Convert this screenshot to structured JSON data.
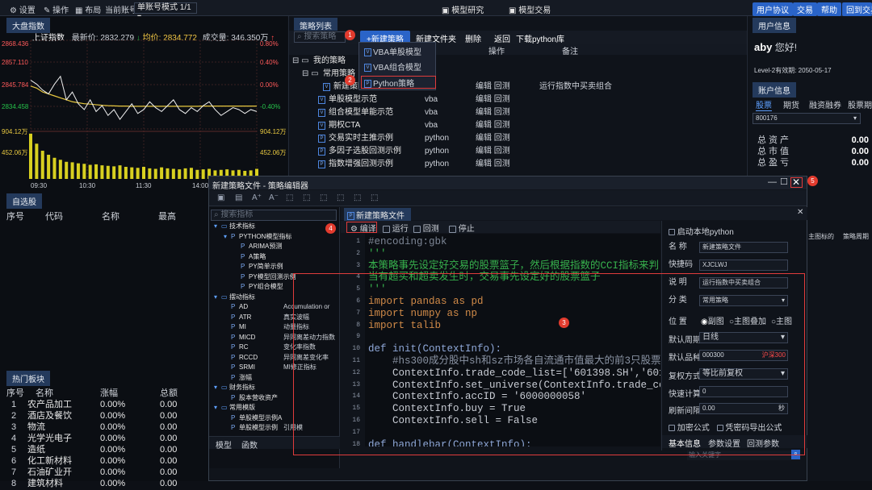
{
  "topbar": {
    "settings": "设置",
    "ops": "操作",
    "layout": "布局",
    "account_label": "当前账号",
    "account_mode": "单账号模式 1/1",
    "model_research": "模型研究",
    "model_trade": "模型交易",
    "user_agreement": "用户协议",
    "trade": "交易",
    "help": "帮助",
    "back_to_trade": "回到交易"
  },
  "market": {
    "tab": "大盘指数",
    "index_name": "上证指数",
    "latest": "最新价: 2832.279",
    "avg": "均价: 2834.772",
    "volume": "成交量: 346.350万",
    "y_left": [
      "2868.436",
      "2857.110",
      "2845.784",
      "2834.458"
    ],
    "y_right": [
      "0.80%",
      "0.40%",
      "0.00%",
      "-0.40%"
    ],
    "vol_left": [
      "904.12万",
      "452.06万"
    ],
    "vol_right": [
      "904.12万",
      "452.06万"
    ],
    "times": [
      "09:30",
      "10:30",
      "11:30",
      "14:00"
    ]
  },
  "chart_data": {
    "type": "line",
    "title": "上证指数",
    "x": [
      "09:30",
      "10:30",
      "11:30",
      "14:00"
    ],
    "ylim": [
      2823.1,
      2868.436
    ],
    "price": [
      2848,
      2846,
      2843,
      2841,
      2846,
      2850,
      2838,
      2842,
      2836,
      2833,
      2838,
      2832,
      2835,
      2830,
      2833,
      2828,
      2832,
      2836,
      2831,
      2833,
      2837,
      2834,
      2832,
      2835,
      2838,
      2833,
      2831,
      2834,
      2832,
      2835,
      2837,
      2833,
      2830,
      2832,
      2834,
      2833,
      2831,
      2833,
      2832
    ],
    "avg": [
      2845,
      2844,
      2842,
      2841,
      2840,
      2839,
      2838,
      2837,
      2836.5,
      2836,
      2835.8,
      2835.5,
      2835.2,
      2835,
      2834.9,
      2834.8,
      2834.8,
      2834.7,
      2834.7,
      2834.7,
      2834.7,
      2834.7,
      2834.7,
      2834.7,
      2834.7,
      2834.7,
      2834.7,
      2834.7,
      2834.7,
      2834.8,
      2834.8,
      2834.8,
      2834.8,
      2834.8,
      2834.8,
      2834.8,
      2834.8,
      2834.8,
      2834.8
    ],
    "volume": [
      900,
      700,
      560,
      480,
      420,
      380,
      340,
      330,
      310,
      300,
      280,
      290,
      270,
      260,
      250,
      270,
      240,
      230,
      220,
      240,
      210,
      200,
      230,
      210,
      200,
      190,
      210,
      220,
      180,
      190,
      200,
      170,
      180,
      190,
      170,
      180,
      160,
      170,
      200
    ]
  },
  "watchlist": {
    "tab": "自选股",
    "cols": [
      "序号",
      "代码",
      "名称",
      "最高"
    ]
  },
  "hot": {
    "tab": "热门板块",
    "cols": [
      "序号",
      "名称",
      "涨幅",
      "总额"
    ],
    "rows": [
      [
        "1",
        "农产品加工",
        "0.00%",
        "0.00"
      ],
      [
        "2",
        "酒店及餐饮",
        "0.00%",
        "0.00"
      ],
      [
        "3",
        "物流",
        "0.00%",
        "0.00"
      ],
      [
        "4",
        "光学光电子",
        "0.00%",
        "0.00"
      ],
      [
        "5",
        "造纸",
        "0.00%",
        "0.00"
      ],
      [
        "6",
        "化工新材料",
        "0.00%",
        "0.00"
      ],
      [
        "7",
        "石油矿业开",
        "0.00%",
        "0.00"
      ],
      [
        "8",
        "建筑材料",
        "0.00%",
        "0.00"
      ]
    ]
  },
  "strategy": {
    "tab": "策略列表",
    "search_placeholder": "搜索策略",
    "new_strategy": "+新建策略",
    "new_folder": "新建文件夹",
    "delete": "删除",
    "back": "返回",
    "download": "下载python库",
    "col_ops": "操作",
    "col_note": "备注",
    "tree": [
      {
        "label": "我的策略",
        "type": "",
        "ops": "",
        "note": ""
      },
      {
        "label": "常用策略",
        "type": "",
        "ops": "",
        "note": ""
      },
      {
        "label": "新建策略文件",
        "type": "",
        "ops": "编辑 回测",
        "note": "运行指数中买卖组合"
      },
      {
        "label": "单股模型示范",
        "type": "vba",
        "ops": "编辑 回测",
        "note": ""
      },
      {
        "label": "组合模型单能示范",
        "type": "vba",
        "ops": "编辑 回测",
        "note": ""
      },
      {
        "label": "期权CTA",
        "type": "vba",
        "ops": "编辑 回测",
        "note": ""
      },
      {
        "label": "交易实时主推示例",
        "type": "python",
        "ops": "编辑 回测",
        "note": ""
      },
      {
        "label": "多因子选股回测示例",
        "type": "python",
        "ops": "编辑 回测",
        "note": ""
      },
      {
        "label": "指数增强回测示例",
        "type": "python",
        "ops": "编辑 回测",
        "note": ""
      }
    ],
    "dropdown": [
      "VBA单股模型",
      "VBA组合模型",
      "Python策略"
    ]
  },
  "user": {
    "tab": "用户信息",
    "name": "aby",
    "greeting": "您好!",
    "level": "Level-2有效期: 2050-05-17"
  },
  "account": {
    "tab": "账户信息",
    "tabs": [
      "股票",
      "期货",
      "融资融券",
      "股票期权"
    ],
    "account_no": "800176",
    "labels": [
      "总资产",
      "总市值",
      "总盈亏"
    ],
    "values": [
      "0.00",
      "0.00",
      "0.00"
    ]
  },
  "editor": {
    "title": "新建策略文件 - 策略编辑器",
    "search_placeholder": "搜索指标",
    "file_tab": "新建策略文件",
    "compile": "编译",
    "run": "运行",
    "backtest": "回测",
    "stop": "停止",
    "bottom_tabs": [
      "模型",
      "函数"
    ],
    "tree": [
      {
        "d": 0,
        "t": "技术指标",
        "s": ""
      },
      {
        "d": 1,
        "t": "PYTHON模型指标",
        "s": ""
      },
      {
        "d": 2,
        "t": "ARIMA预测",
        "s": ""
      },
      {
        "d": 2,
        "t": "A策略",
        "s": ""
      },
      {
        "d": 2,
        "t": "PY简单示例",
        "s": ""
      },
      {
        "d": 2,
        "t": "PY模型回测示例",
        "s": ""
      },
      {
        "d": 2,
        "t": "PY组合模型",
        "s": ""
      },
      {
        "d": 0,
        "t": "摆动指标",
        "s": ""
      },
      {
        "d": 1,
        "t": "AD",
        "s": "Accumulation or"
      },
      {
        "d": 1,
        "t": "ATR",
        "s": "真实波幅"
      },
      {
        "d": 1,
        "t": "MI",
        "s": "动量指标"
      },
      {
        "d": 1,
        "t": "MICD",
        "s": "异同离差动力指数"
      },
      {
        "d": 1,
        "t": "RC",
        "s": "变化率指数"
      },
      {
        "d": 1,
        "t": "RCCD",
        "s": "异同离差变化率"
      },
      {
        "d": 1,
        "t": "SRMI",
        "s": "MI修正指标"
      },
      {
        "d": 1,
        "t": "涨幅",
        "s": ""
      },
      {
        "d": 0,
        "t": "财务指标",
        "s": ""
      },
      {
        "d": 1,
        "t": "股本营收资产",
        "s": ""
      },
      {
        "d": 0,
        "t": "常用模版",
        "s": ""
      },
      {
        "d": 1,
        "t": "单股模型示例A",
        "s": ""
      },
      {
        "d": 1,
        "t": "单股模型示例",
        "s": "引用模"
      }
    ],
    "code": [
      "#encoding:gbk",
      "'''",
      "本策略事先设定好交易的股票篮子，然后根据指数的CCI指标来判",
      "当有超买和超卖发生时，交易事先设定好的股票篮子",
      "'''",
      "import pandas as pd",
      "import numpy as np",
      "import talib",
      "",
      "def init(ContextInfo):",
      "    #hs300成分股中sh和sz市场各自流通市值最大的前3只股票",
      "    ContextInfo.trade_code_list=['601398.SH','6018",
      "    ContextInfo.set_universe(ContextInfo.trade_code",
      "    ContextInfo.accID = '6000000058'",
      "    ContextInfo.buy = True",
      "    ContextInfo.sell = False",
      "",
      "def handlebar(ContextInfo):"
    ]
  },
  "props": {
    "local_python": "启动本地python",
    "fields": [
      [
        "名 称",
        "新建策略文件"
      ],
      [
        "快捷码",
        "XJCLWJ"
      ],
      [
        "说 明",
        "运行指数中买卖组合"
      ],
      [
        "分 类",
        "常用策略"
      ]
    ],
    "pos_label": "位 置",
    "pos_opts": [
      "副图",
      "主图叠加",
      "主图"
    ],
    "period_label": "默认周期",
    "period": "日线",
    "stock_label": "默认品种",
    "stock_code": "000300",
    "stock_name": "沪深300",
    "rights_label": "复权方式",
    "rights": "等比前复权",
    "fast_label": "快速计算",
    "fast": "0",
    "refresh_label": "刷新间隔",
    "refresh": "0.00",
    "refresh_unit": "秒",
    "encrypt": "加密公式",
    "export_encrypt": "凭密码导出公式",
    "tabs": [
      "基本信息",
      "参数设置",
      "回测参数"
    ],
    "input_placeholder": "输入关键字"
  },
  "right_peek": {
    "c1": "主图标的",
    "c2": "策略周期"
  },
  "badges": [
    "1",
    "2",
    "3",
    "4",
    "5"
  ]
}
